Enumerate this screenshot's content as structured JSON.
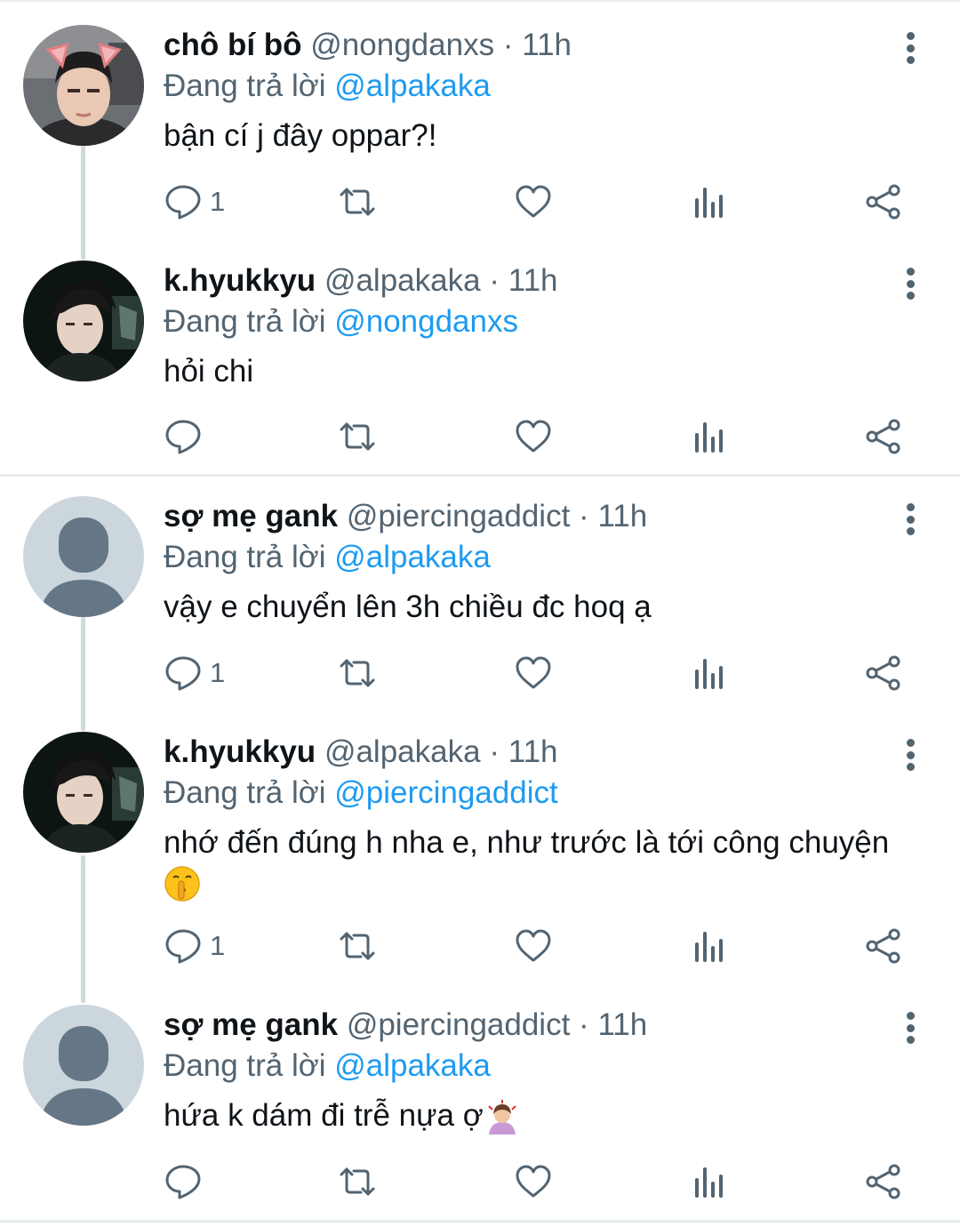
{
  "reply_prefix": "Đang trả lời",
  "dot": "·",
  "tweets": [
    {
      "name": "chô bí bô",
      "handle": "@nongdanxs",
      "time": "11h",
      "reply_to": "@alpakaka",
      "text": "bận cí j đây oppar?!",
      "reply_count": "1",
      "avatar": "cat-ear-boy-avatar"
    },
    {
      "name": "k.hyukkyu",
      "handle": "@alpakaka",
      "time": "11h",
      "reply_to": "@nongdanxs",
      "text": "hỏi chi",
      "reply_count": "",
      "avatar": "dark-portrait-avatar"
    },
    {
      "name": "sợ mẹ gank",
      "handle": "@piercingaddict",
      "time": "11h",
      "reply_to": "@alpakaka",
      "text": "vậy e chuyển lên 3h chiều đc hoq ạ",
      "reply_count": "1",
      "avatar": "default-avatar"
    },
    {
      "name": "k.hyukkyu",
      "handle": "@alpakaka",
      "time": "11h",
      "reply_to": "@piercingaddict",
      "text": "nhớ đến đúng h nha e, như trước là tới công chuyện",
      "reply_count": "1",
      "avatar": "dark-portrait-avatar",
      "emoji": "shushing-face-emoji"
    },
    {
      "name": "sợ mẹ gank",
      "handle": "@piercingaddict",
      "time": "11h",
      "reply_to": "@alpakaka",
      "text": "hứa k dám đi trễ nựa ợ",
      "reply_count": "",
      "avatar": "default-avatar",
      "emoji": "person-bowing-emoji"
    }
  ],
  "colors": {
    "accent": "#1d9bf0",
    "secondary_text": "#536471",
    "primary_text": "#0f1419",
    "thread_line": "#cfd9de",
    "default_avatar_bg": "#ccd6dd",
    "default_avatar_fg": "#657786"
  }
}
